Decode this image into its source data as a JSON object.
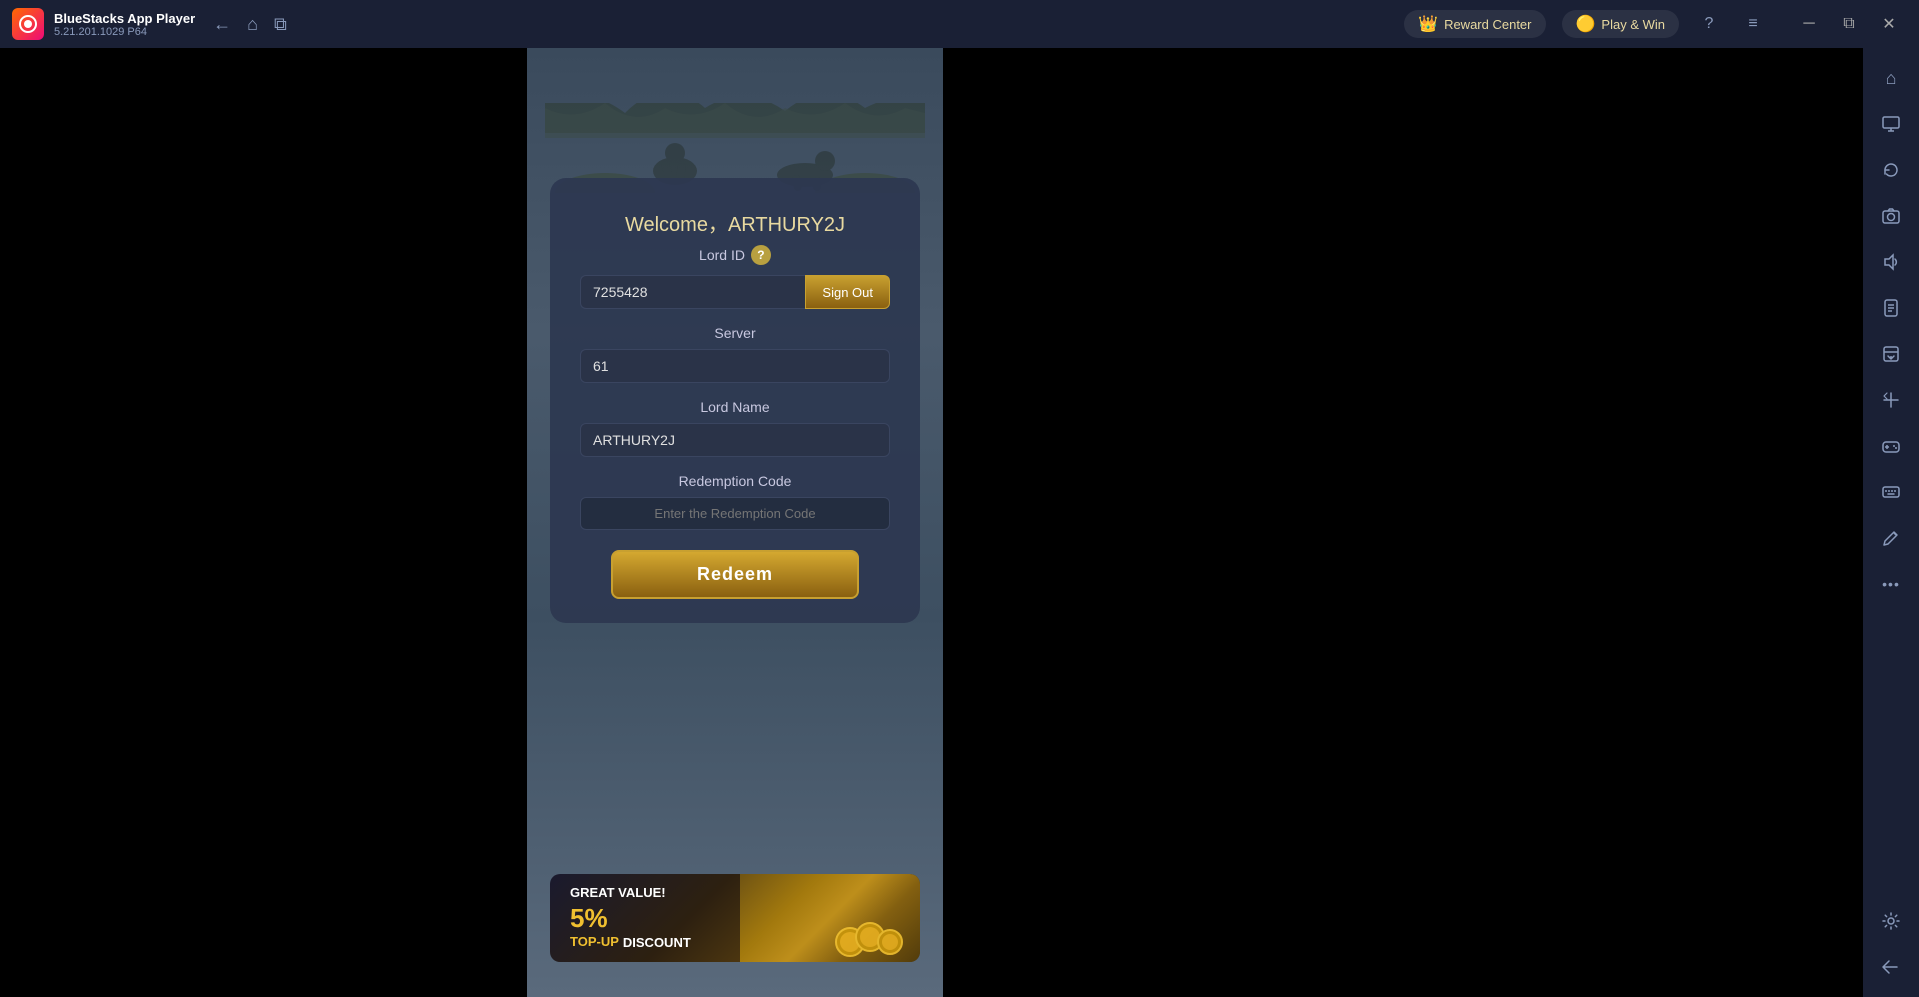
{
  "titlebar": {
    "app_name": "BlueStacks App Player",
    "version": "5.21.201.1029  P64",
    "nav": {
      "back_label": "←",
      "home_label": "⌂",
      "tab_label": "⧉"
    },
    "reward_center": {
      "icon": "👑",
      "label": "Reward Center"
    },
    "play_win": {
      "icon": "🟡",
      "label": "Play & Win"
    },
    "help_icon": "?",
    "menu_icon": "≡",
    "minimize_icon": "─",
    "maximize_icon": "⧉",
    "close_icon": "✕"
  },
  "game": {
    "welcome_text": "Welcome，ARTHURY2J",
    "lord_id_label": "Lord ID",
    "lord_id_value": "7255428",
    "sign_out_label": "Sign Out",
    "server_label": "Server",
    "server_value": "61",
    "lord_name_label": "Lord Name",
    "lord_name_value": "ARTHURY2J",
    "redemption_code_label": "Redemption Code",
    "redemption_code_placeholder": "Enter the Redemption Code",
    "redeem_button_label": "Redeem",
    "banner": {
      "great_value": "GREAT",
      "value_label": "VALUE!",
      "percent": "5%",
      "topup_label": "TOP-UP",
      "discount_label": "DISCOUNT"
    }
  },
  "sidebar": {
    "icons": [
      {
        "name": "home-icon",
        "symbol": "⌂"
      },
      {
        "name": "monitor-icon",
        "symbol": "🖥"
      },
      {
        "name": "rotate-icon",
        "symbol": "↻"
      },
      {
        "name": "camera-icon",
        "symbol": "📷"
      },
      {
        "name": "volume-icon",
        "symbol": "🔊"
      },
      {
        "name": "apk-icon",
        "symbol": "📦"
      },
      {
        "name": "screenshot-icon",
        "symbol": "📸"
      },
      {
        "name": "resize-icon",
        "symbol": "⤡"
      },
      {
        "name": "gamepad-icon",
        "symbol": "🎮"
      },
      {
        "name": "keyboard-icon",
        "symbol": "⌨"
      },
      {
        "name": "edit-icon",
        "symbol": "✏"
      },
      {
        "name": "dots-icon",
        "symbol": "•••"
      },
      {
        "name": "settings-icon",
        "symbol": "⚙"
      },
      {
        "name": "back-icon",
        "symbol": "↩"
      }
    ]
  }
}
